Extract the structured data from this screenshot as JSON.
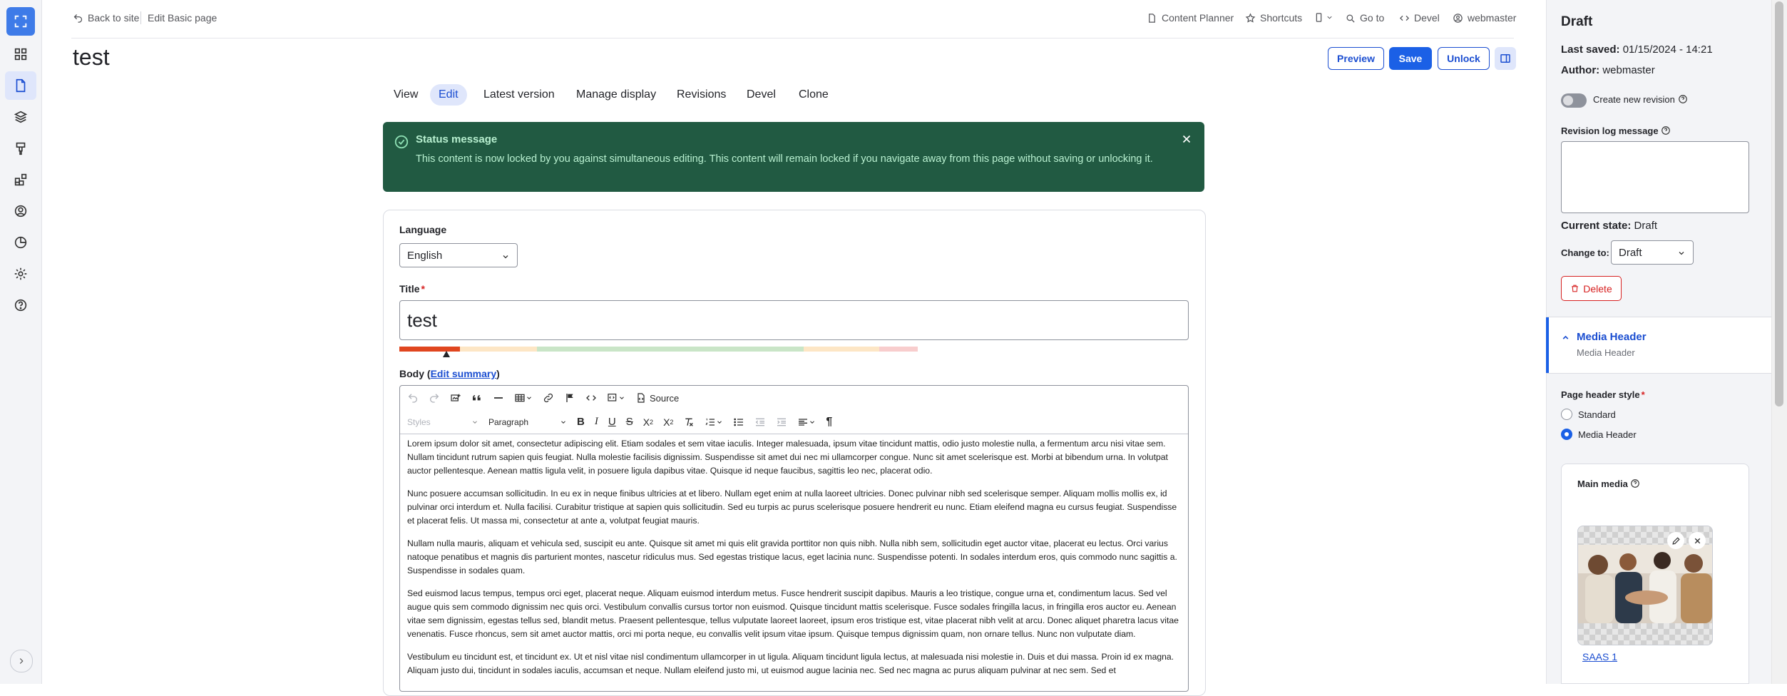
{
  "topbar": {
    "back_to_site": "Back to site",
    "edit_basic_page": "Edit Basic page",
    "content_planner": "Content Planner",
    "shortcuts": "Shortcuts",
    "go_to": "Go to",
    "devel": "Devel",
    "user": "webmaster"
  },
  "page": {
    "title": "test",
    "buttons": {
      "preview": "Preview",
      "save": "Save",
      "unlock": "Unlock"
    }
  },
  "tabs": [
    "View",
    "Edit",
    "Latest version",
    "Manage display",
    "Revisions",
    "Devel",
    "Clone"
  ],
  "status": {
    "title": "Status message",
    "text": "This content is now locked by you against simultaneous editing. This content will remain locked if you navigate away from this page without saving or unlocking it."
  },
  "form": {
    "language_label": "Language",
    "language_value": "English",
    "title_label": "Title",
    "title_value": "test",
    "body_label": "Body",
    "edit_summary": "Edit summary",
    "toolbar": {
      "source": "Source",
      "styles": "Styles",
      "paragraph": "Paragraph"
    },
    "body_paragraphs": [
      "Lorem ipsum dolor sit amet, consectetur adipiscing elit. Etiam sodales et sem vitae iaculis. Integer malesuada, ipsum vitae tincidunt mattis, odio justo molestie nulla, a fermentum arcu nisi vitae sem. Nullam tincidunt rutrum sapien quis feugiat. Nulla molestie facilisis dignissim. Suspendisse sit amet dui nec mi ullamcorper congue. Nunc sit amet scelerisque est. Morbi at bibendum urna. In volutpat auctor pellentesque. Aenean mattis ligula velit, in posuere ligula dapibus vitae. Quisque id neque faucibus, sagittis leo nec, placerat odio.",
      "Nunc posuere accumsan sollicitudin. In eu ex in neque finibus ultricies at et libero. Nullam eget enim at nulla laoreet ultricies. Donec pulvinar nibh sed scelerisque semper. Aliquam mollis mollis ex, id pulvinar orci interdum et. Nulla facilisi. Curabitur tristique at sapien quis sollicitudin. Sed eu turpis ac purus scelerisque posuere hendrerit eu nunc. Etiam eleifend magna eu cursus feugiat. Suspendisse et placerat felis. Ut massa mi, consectetur at ante a, volutpat feugiat mauris.",
      "Nullam nulla mauris, aliquam et vehicula sed, suscipit eu ante. Quisque sit amet mi quis elit gravida porttitor non quis nibh. Nulla nibh sem, sollicitudin eget auctor vitae, placerat eu lectus. Orci varius natoque penatibus et magnis dis parturient montes, nascetur ridiculus mus. Sed egestas tristique lacus, eget lacinia nunc. Suspendisse potenti. In sodales interdum eros, quis commodo nunc sagittis a. Suspendisse in sodales quam.",
      "Sed euismod lacus tempus, tempus orci eget, placerat neque. Aliquam euismod interdum metus. Fusce hendrerit suscipit dapibus. Mauris a leo tristique, congue urna et, condimentum lacus. Sed vel augue quis sem commodo dignissim nec quis orci. Vestibulum convallis cursus tortor non euismod. Quisque tincidunt mattis scelerisque. Fusce sodales fringilla lacus, in fringilla eros auctor eu. Aenean vitae sem dignissim, egestas tellus sed, blandit metus. Praesent pellentesque, tellus vulputate laoreet laoreet, ipsum eros tristique est, vitae placerat nibh velit at arcu. Donec aliquet pharetra lacus vitae venenatis. Fusce rhoncus, sem sit amet auctor mattis, orci mi porta neque, eu convallis velit ipsum vitae ipsum. Quisque tempus dignissim quam, non ornare tellus. Nunc non vulputate diam.",
      "Vestibulum eu tincidunt est, et tincidunt ex. Ut et nisl vitae nisl condimentum ullamcorper in ut ligula. Aliquam tincidunt ligula lectus, at malesuada nisi molestie in. Duis et dui massa. Proin id ex magna. Aliquam justo dui, tincidunt in sodales iaculis, accumsan et neque. Nullam eleifend justo mi, ut euismod augue lacinia nec. Sed nec magna ac purus aliquam pulvinar at nec sem. Sed et"
    ]
  },
  "sidebar": {
    "state_title": "Draft",
    "last_saved_label": "Last saved:",
    "last_saved_value": "01/15/2024 - 14:21",
    "author_label": "Author:",
    "author_value": "webmaster",
    "create_revision": "Create new revision",
    "revision_log_label": "Revision log message",
    "current_state_label": "Current state:",
    "current_state_value": "Draft",
    "change_to_label": "Change to:",
    "change_to_value": "Draft",
    "delete": "Delete",
    "media_header_title": "Media Header",
    "media_header_sub": "Media Header",
    "page_header_style_label": "Page header style",
    "option_standard": "Standard",
    "option_media_header": "Media Header",
    "main_media_label": "Main media",
    "media_name": "SAAS 1"
  },
  "colors": {
    "accent": "#1b60e6",
    "status_bg": "#215a42",
    "danger": "#d72222"
  },
  "meter": {
    "segments": [
      {
        "color": "#e0461f",
        "share": 0.077
      },
      {
        "color": "#fde6c5",
        "share": 0.097
      },
      {
        "color": "#c9e5c7",
        "share": 0.338
      },
      {
        "color": "#fde6c5",
        "share": 0.096
      },
      {
        "color": "#f8cdcd",
        "share": 0.049
      }
    ],
    "value": 0.077
  }
}
